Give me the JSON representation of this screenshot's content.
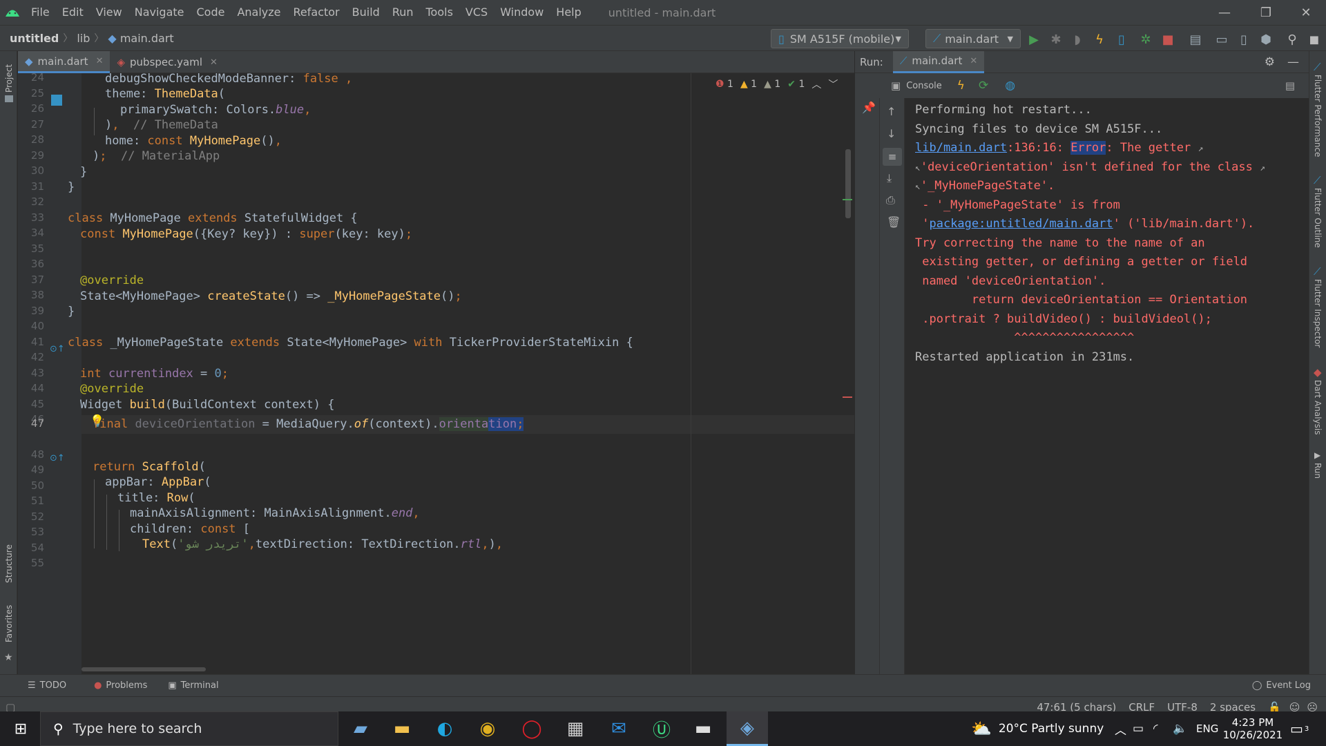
{
  "menubar": {
    "items": [
      "File",
      "Edit",
      "View",
      "Navigate",
      "Code",
      "Analyze",
      "Refactor",
      "Build",
      "Run",
      "Tools",
      "VCS",
      "Window",
      "Help"
    ],
    "window_title": "untitled - main.dart"
  },
  "navbar": {
    "breadcrumbs": [
      "untitled",
      "lib",
      "main.dart"
    ],
    "device": "SM A515F (mobile)",
    "run_config": "main.dart"
  },
  "left_stripe": {
    "project": "Project",
    "structure": "Structure",
    "favorites": "Favorites"
  },
  "right_stripe": {
    "perf": "Flutter Performance",
    "outline": "Flutter Outline",
    "inspector": "Flutter Inspector",
    "dart": "Dart Analysis",
    "run": "Run"
  },
  "editor": {
    "tabs": [
      {
        "label": "main.dart",
        "active": true
      },
      {
        "label": "pubspec.yaml",
        "active": false
      }
    ],
    "inspections": {
      "errors": "1",
      "warnings": "1",
      "weak_warnings": "1",
      "typos": "1"
    },
    "line_numbers": [
      "24",
      "25",
      "26",
      "27",
      "28",
      "29",
      "30",
      "31",
      "32",
      "33",
      "34",
      "35",
      "36",
      "37",
      "38",
      "39",
      "40",
      "41",
      "42",
      "43",
      "44",
      "45",
      "46",
      "47",
      "48",
      "49",
      "50",
      "51",
      "52",
      "53",
      "54",
      "55"
    ],
    "current_line": "47"
  },
  "run_panel": {
    "label": "Run:",
    "tab": "main.dart",
    "console_tab": "Console",
    "output": [
      "Performing hot restart...",
      "Syncing files to device SM A515F...",
      "lib/main.dart",
      ":136:16: ",
      "Error",
      ": The getter ",
      "'deviceOrientation' isn't defined for the class ",
      "'_MyHomePageState'.",
      " - '_MyHomePageState' is from",
      "package:untitled/main.dart",
      "' ('lib/main.dart').",
      "Try correcting the name to the name of an",
      " existing getter, or defining a getter or field",
      " named 'deviceOrientation'.",
      "        return deviceOrientation == Orientation",
      " .portrait ? buildVideo() : buildVideol();",
      "              ^^^^^^^^^^^^^^^^^",
      "Restarted application in 231ms."
    ]
  },
  "bottom_tools": {
    "todo": "TODO",
    "problems": "Problems",
    "terminal": "Terminal",
    "event_log": "Event Log"
  },
  "statusbar": {
    "position": "47:61 (5 chars)",
    "line_sep": "CRLF",
    "encoding": "UTF-8",
    "indent": "2 spaces"
  },
  "taskbar": {
    "search_placeholder": "Type here to search",
    "weather": "20°C  Partly sunny",
    "lang": "ENG",
    "time": "4:23 PM",
    "date": "10/26/2021",
    "notifications": "3"
  }
}
